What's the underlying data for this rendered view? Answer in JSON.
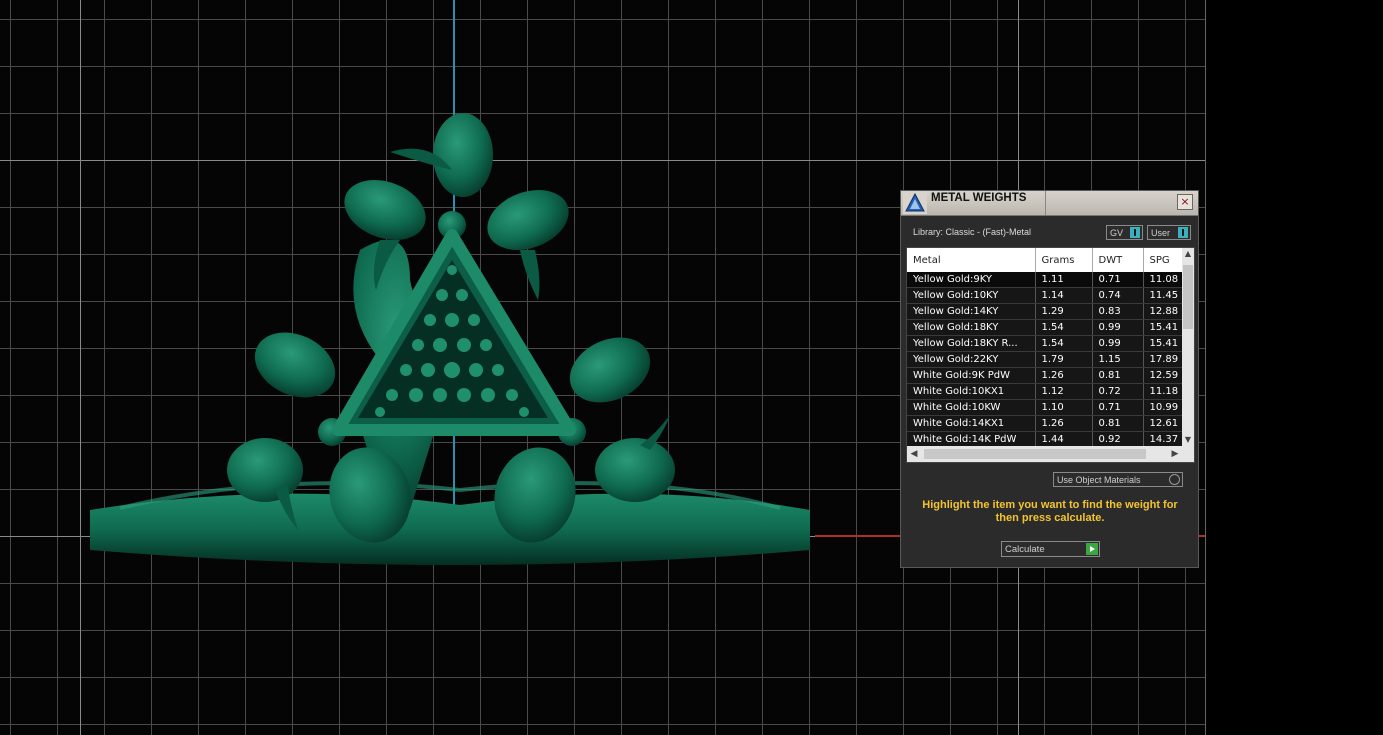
{
  "dialog": {
    "title": "METAL WEIGHTS",
    "close_label": "×",
    "library_label": "Library: Classic - (Fast)-Metal",
    "toggle_gv": "GV",
    "toggle_user": "User",
    "columns": [
      "Metal",
      "Grams",
      "DWT",
      "SPG"
    ],
    "rows": [
      [
        "Yellow Gold:9KY",
        "1.11",
        "0.71",
        "11.08"
      ],
      [
        "Yellow Gold:10KY",
        "1.14",
        "0.74",
        "11.45"
      ],
      [
        "Yellow Gold:14KY",
        "1.29",
        "0.83",
        "12.88"
      ],
      [
        "Yellow Gold:18KY",
        "1.54",
        "0.99",
        "15.41"
      ],
      [
        "Yellow Gold:18KY R...",
        "1.54",
        "0.99",
        "15.41"
      ],
      [
        "Yellow Gold:22KY",
        "1.79",
        "1.15",
        "17.89"
      ],
      [
        "White Gold:9K PdW",
        "1.26",
        "0.81",
        "12.59"
      ],
      [
        "White Gold:10KX1",
        "1.12",
        "0.72",
        "11.18"
      ],
      [
        "White Gold:10KW",
        "1.10",
        "0.71",
        "10.99"
      ],
      [
        "White Gold:14KX1",
        "1.26",
        "0.81",
        "12.61"
      ],
      [
        "White Gold:14K PdW",
        "1.44",
        "0.92",
        "14.37"
      ]
    ],
    "use_object_materials": "Use Object Materials",
    "hint": "Highlight the item you want to find the weight for then press calculate.",
    "calculate_label": "Calculate"
  },
  "colors": {
    "model": "#0f6b50",
    "axis_y": "#2b8fb0",
    "axis_x": "#b03020",
    "hint": "#f4c430"
  }
}
